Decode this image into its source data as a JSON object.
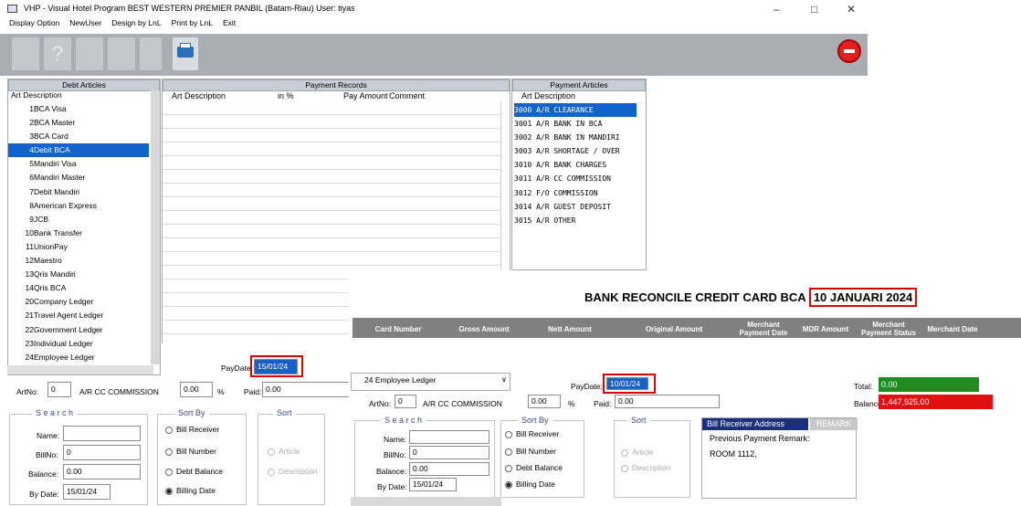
{
  "window": {
    "title": "VHP - Visual Hotel Program      BEST WESTERN PREMIER PANBIL (Batam-Riau) User: tiyas",
    "min": "–",
    "max": "□",
    "close": "✕"
  },
  "menu": [
    "Display Option",
    "NewUser",
    "Design by LnL",
    "Print by LnL",
    "Exit"
  ],
  "debt": {
    "header": "Debt Articles",
    "col": "Art Description",
    "rows": [
      {
        "no": "1",
        "desc": "BCA Visa"
      },
      {
        "no": "2",
        "desc": "BCA Master"
      },
      {
        "no": "3",
        "desc": "BCA Card"
      },
      {
        "no": "4",
        "desc": "Debit BCA"
      },
      {
        "no": "5",
        "desc": "Mandiri Visa"
      },
      {
        "no": "6",
        "desc": "Mandiri Master"
      },
      {
        "no": "7",
        "desc": "Debit Mandiri"
      },
      {
        "no": "8",
        "desc": "American Express"
      },
      {
        "no": "9",
        "desc": "JCB"
      },
      {
        "no": "10",
        "desc": "Bank Transfer"
      },
      {
        "no": "11",
        "desc": "UnionPay"
      },
      {
        "no": "12",
        "desc": "Maestro"
      },
      {
        "no": "13",
        "desc": "Qris Mandiri"
      },
      {
        "no": "14",
        "desc": "Qris BCA"
      },
      {
        "no": "20",
        "desc": "Company Ledger"
      },
      {
        "no": "21",
        "desc": "Travel Agent Ledger"
      },
      {
        "no": "22",
        "desc": "Government Ledger"
      },
      {
        "no": "23",
        "desc": "Individual Ledger"
      },
      {
        "no": "24",
        "desc": "Employee Ledger"
      }
    ]
  },
  "payrec": {
    "header": "Payment Records",
    "c1": "Art Description",
    "c2": "in %",
    "c3": "Pay Amount",
    "c4": "Comment"
  },
  "payart": {
    "header": "Payment Articles",
    "col": "Art Description",
    "rows": [
      "3000 A/R CLEARANCE",
      "3001 A/R BANK IN BCA",
      "3002 A/R BANK IN MANDIRI",
      "3003 A/R SHORTAGE / OVER",
      "3010 A/R BANK CHARGES",
      "3011 A/R CC COMMISSION",
      "3012 F/O COMMISSION",
      "3014 A/R GUEST DEPOSIT",
      "3015 A/R OTHER"
    ]
  },
  "form1": {
    "paydate_label": "PayDate:",
    "paydate": "15/01/24",
    "artno_label": "ArtNo:",
    "artno": "0",
    "artname": "A/R CC COMMISSION",
    "pct": "0.00",
    "pct_sym": "%",
    "paid_label": "Paid:",
    "paid": "0.00",
    "search": "S e a r c h",
    "name_label": "Name:",
    "billno_label": "BillNo:",
    "billno": "0",
    "balance_label": "Balance:",
    "balance": "0.00",
    "bydate_label": "By Date:",
    "bydate": "15/01/24",
    "sortby": "Sort By",
    "r1": "Bill Receiver",
    "r2": "Bill Number",
    "r3": "Debt Balance",
    "r4": "Billing Date",
    "sort": "Sort",
    "s1": "Article",
    "s2": "Description"
  },
  "report": {
    "title_a": "BANK RECONCILE CREDIT CARD BCA",
    "title_b": "10 JANUARI 2024",
    "cols": [
      "Card Number",
      "Gross Amount",
      "Nett Amount",
      "Original Amount",
      "Merchant Payment Date",
      "MDR Amount",
      "Merchant Payment Status",
      "Merchant Date"
    ]
  },
  "form2": {
    "ledger": "24 Employee Ledger",
    "paydate_label": "PayDate:",
    "paydate": "10/01/24",
    "artno_label": "ArtNo:",
    "artno": "0",
    "artname": "A/R CC COMMISSION",
    "pct": "0.00",
    "pct_sym": "%",
    "paid_label": "Paid:",
    "paid": "0.00",
    "search": "S e a r c h",
    "name_label": "Name:",
    "billno_label": "BillNo:",
    "billno": "0",
    "balance_label": "Balance:",
    "balance": "0.00",
    "bydate_label": "By Date:",
    "bydate": "15/01/24",
    "sortby": "Sort By",
    "r1": "Bill Receiver",
    "r2": "Bill Number",
    "r3": "Debt Balance",
    "r4": "Billing Date",
    "sort": "Sort",
    "s1": "Article",
    "s2": "Description",
    "total_label": "Total:",
    "total": "0.00",
    "bal_label": "Balance:",
    "bal": "1,447,925.00",
    "addr_label": "Bill Receiver Address",
    "remark_label": "REMARK",
    "prev_label": "Previous Payment Remark:",
    "room": "ROOM 1112,"
  }
}
